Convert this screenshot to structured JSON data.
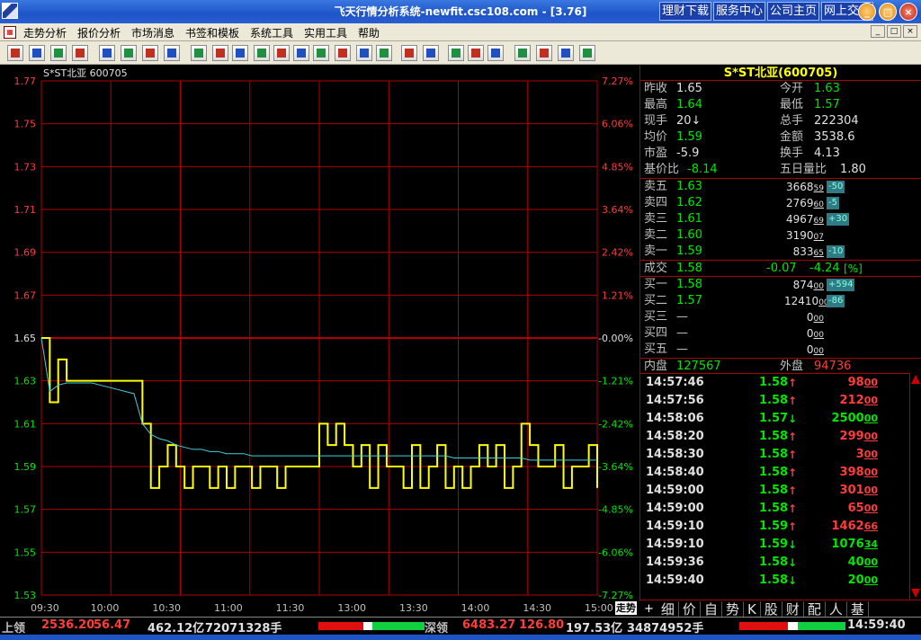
{
  "window": {
    "title": "飞天行情分析系统-newfit.csc108.com - [3.76]",
    "links": [
      "理财下载",
      "服务中心",
      "公司主页",
      "网上交易"
    ],
    "minimize": "_",
    "maximize": "□",
    "close": "×"
  },
  "menu": {
    "items": [
      "走势分析",
      "报价分析",
      "市场消息",
      "书签和模板",
      "系统工具",
      "实用工具",
      "帮助"
    ]
  },
  "toolbar": {
    "buttons": [
      "back",
      "board",
      "SH",
      "SZ",
      "A",
      "ASH",
      "ASZ",
      "pick",
      "line",
      "kline",
      "day",
      "month",
      "5min",
      "15min",
      "60min",
      "trend",
      "detail",
      "volume",
      "table",
      "A-ratio",
      "net1",
      "net2",
      "net3",
      "news",
      "f10",
      "calc",
      "alarm"
    ]
  },
  "chart_data": {
    "type": "line",
    "title": "S*ST北亚  600705",
    "x": [
      "09:30",
      "10:00",
      "10:30",
      "11:00",
      "11:30",
      "13:00",
      "13:30",
      "14:00",
      "14:30",
      "15:00"
    ],
    "xlabel": "",
    "ylabel": "",
    "ylim": [
      1.53,
      1.77
    ],
    "y_ticks": [
      "1.77",
      "1.75",
      "1.73",
      "1.71",
      "1.69",
      "1.67",
      "1.65",
      "1.63",
      "1.61",
      "1.59",
      "1.57",
      "1.55",
      "1.53"
    ],
    "y_ticks_pct": [
      "7.27%",
      "6.06%",
      "4.85%",
      "3.64%",
      "2.42%",
      "1.21%",
      "-0.00%",
      "-1.21%",
      "-2.42%",
      "-3.64%",
      "-4.85%",
      "-6.06%",
      "-7.27%"
    ],
    "prev_close": 1.65,
    "grid": true,
    "series": [
      {
        "color": "#ffff00",
        "step_minutes": 5,
        "values": [
          1.65,
          1.62,
          1.64,
          1.63,
          1.63,
          1.63,
          1.63,
          1.63,
          1.63,
          1.63,
          1.63,
          1.63,
          1.61,
          1.58,
          1.59,
          1.6,
          1.59,
          1.58,
          1.59,
          1.59,
          1.58,
          1.59,
          1.58,
          1.59,
          1.59,
          1.58,
          1.59,
          1.59,
          1.58,
          1.59,
          1.59,
          1.59,
          1.59,
          1.61,
          1.6,
          1.61,
          1.6,
          1.59,
          1.6,
          1.58,
          1.6,
          1.59,
          1.59,
          1.58,
          1.6,
          1.58,
          1.59,
          1.6,
          1.58,
          1.59,
          1.58,
          1.59,
          1.6,
          1.59,
          1.6,
          1.58,
          1.59,
          1.61,
          1.6,
          1.59,
          1.59,
          1.6,
          1.58,
          1.59,
          1.59,
          1.6,
          1.58
        ]
      },
      {
        "color": "#40d0e0",
        "step_minutes": 5,
        "values": [
          1.65,
          1.625,
          1.628,
          1.629,
          1.629,
          1.629,
          1.629,
          1.628,
          1.627,
          1.626,
          1.625,
          1.624,
          1.61,
          1.605,
          1.603,
          1.602,
          1.6,
          1.599,
          1.598,
          1.598,
          1.597,
          1.597,
          1.596,
          1.596,
          1.596,
          1.595,
          1.595,
          1.595,
          1.595,
          1.595,
          1.595,
          1.595,
          1.595,
          1.595,
          1.595,
          1.595,
          1.595,
          1.595,
          1.595,
          1.595,
          1.595,
          1.595,
          1.595,
          1.595,
          1.595,
          1.595,
          1.595,
          1.595,
          1.595,
          1.594,
          1.594,
          1.594,
          1.594,
          1.594,
          1.594,
          1.594,
          1.594,
          1.594,
          1.593,
          1.593,
          1.593,
          1.593,
          1.593,
          1.593,
          1.593,
          1.593,
          1.593
        ]
      }
    ]
  },
  "chart": {
    "tab_label": "走势"
  },
  "panel": {
    "header": "S*ST北亚(600705)",
    "quote": [
      {
        "l1": "昨收",
        "v1": "1.65",
        "c1": "w",
        "l2": "今开",
        "v2": "1.63",
        "c2": "g"
      },
      {
        "l1": "最高",
        "v1": "1.64",
        "c1": "g",
        "l2": "最低",
        "v2": "1.57",
        "c2": "g"
      },
      {
        "l1": "现手",
        "v1": "20↓",
        "c1": "w",
        "l2": "总手",
        "v2": "222304",
        "c2": "w"
      },
      {
        "l1": "均价",
        "v1": "1.59",
        "c1": "g",
        "l2": "金额",
        "v2": "3538.6",
        "c2": "w"
      },
      {
        "l1": "市盈",
        "v1": "-5.9",
        "c1": "w",
        "l2": "换手",
        "v2": "4.13",
        "c2": "w"
      },
      {
        "l1": "基价比",
        "v1": "-8.14",
        "c1": "g",
        "l2": "五日量比",
        "v2": "1.80",
        "c2": "w"
      }
    ],
    "sells": [
      {
        "label": "卖五",
        "price": "1.63",
        "vol": "3668",
        "vol_small": "59",
        "chg": "-50"
      },
      {
        "label": "卖四",
        "price": "1.62",
        "vol": "2769",
        "vol_small": "60",
        "chg": "-5"
      },
      {
        "label": "卖三",
        "price": "1.61",
        "vol": "4967",
        "vol_small": "69",
        "chg": "+30"
      },
      {
        "label": "卖二",
        "price": "1.60",
        "vol": "3190",
        "vol_small": "07",
        "chg": ""
      },
      {
        "label": "卖一",
        "price": "1.59",
        "vol": "833",
        "vol_small": "65",
        "chg": "-10"
      }
    ],
    "deal": {
      "label": "成交",
      "price": "1.58",
      "change": "-0.07",
      "pct": "-4.24",
      "pct_unit": "[%]"
    },
    "buys": [
      {
        "label": "买一",
        "price": "1.58",
        "vol": "874",
        "vol_small": "00",
        "chg": "+594"
      },
      {
        "label": "买二",
        "price": "1.57",
        "vol": "12410",
        "vol_small": "00",
        "chg": "-86"
      },
      {
        "label": "买三",
        "price": "—",
        "vol": "0",
        "vol_small": "00",
        "chg": ""
      },
      {
        "label": "买四",
        "price": "—",
        "vol": "0",
        "vol_small": "00",
        "chg": ""
      },
      {
        "label": "买五",
        "price": "—",
        "vol": "0",
        "vol_small": "00",
        "chg": ""
      }
    ],
    "inner": {
      "label": "内盘",
      "value": "127567"
    },
    "outer": {
      "label": "外盘",
      "value": "94736"
    },
    "trades": [
      {
        "time": "14:57:46",
        "price": "1.58",
        "dir": "up",
        "vol": "98",
        "vol_small": "00"
      },
      {
        "time": "14:57:56",
        "price": "1.58",
        "dir": "up",
        "vol": "212",
        "vol_small": "00"
      },
      {
        "time": "14:58:06",
        "price": "1.57",
        "dir": "down",
        "vol": "2500",
        "vol_small": "00"
      },
      {
        "time": "14:58:20",
        "price": "1.58",
        "dir": "up",
        "vol": "299",
        "vol_small": "00"
      },
      {
        "time": "14:58:30",
        "price": "1.58",
        "dir": "up",
        "vol": "3",
        "vol_small": "00"
      },
      {
        "time": "14:58:40",
        "price": "1.58",
        "dir": "up",
        "vol": "398",
        "vol_small": "00"
      },
      {
        "time": "14:59:00",
        "price": "1.58",
        "dir": "up",
        "vol": "301",
        "vol_small": "00"
      },
      {
        "time": "14:59:00",
        "price": "1.58",
        "dir": "up",
        "vol": "65",
        "vol_small": "00"
      },
      {
        "time": "14:59:10",
        "price": "1.59",
        "dir": "up",
        "vol": "1462",
        "vol_small": "66"
      },
      {
        "time": "14:59:10",
        "price": "1.59",
        "dir": "down",
        "vol": "1076",
        "vol_small": "34"
      },
      {
        "time": "14:59:36",
        "price": "1.58",
        "dir": "down",
        "vol": "40",
        "vol_small": "00"
      },
      {
        "time": "14:59:40",
        "price": "1.58",
        "dir": "down",
        "vol": "20",
        "vol_small": "00"
      }
    ],
    "tabs": [
      "细",
      "价",
      "自",
      "势",
      "K",
      "股",
      "财",
      "配",
      "人",
      "基"
    ],
    "tab_plus": "+"
  },
  "status": {
    "sh_label": "上领",
    "sh_index": "2536.20",
    "sh_change": "56.47",
    "sh_amount": "462.12亿",
    "sh_volume": "72071328手",
    "sz_label": "深领",
    "sz_index": "6483.27",
    "sz_change": "126.80",
    "sz_amount": "197.53亿",
    "sz_volume": "34874952手",
    "time": "14:59:40",
    "sh_ratio": {
      "red": 0.42,
      "white": 0.09,
      "green": 0.49
    },
    "sz_ratio": {
      "red": 0.46,
      "white": 0.09,
      "green": 0.45
    }
  },
  "colors": {
    "up": "#ff3c3c",
    "down": "#00e600",
    "grid": "#b00000",
    "price_line": "#ffff00",
    "avg_line": "#40d0e0",
    "bg": "#000000"
  }
}
